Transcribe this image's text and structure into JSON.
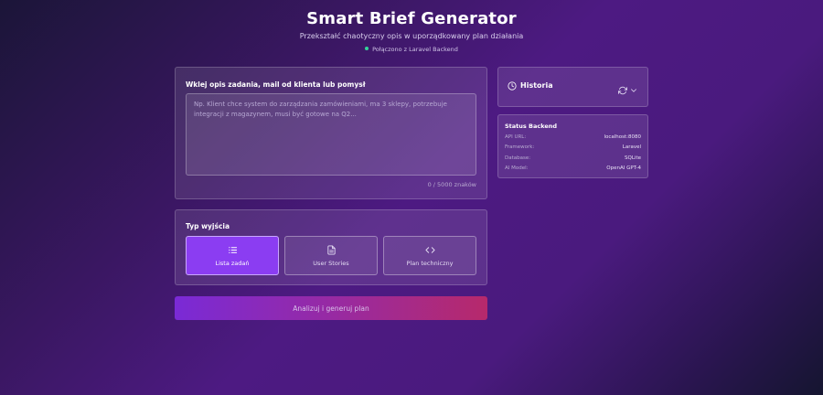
{
  "header": {
    "title": "Smart Brief Generator",
    "subtitle": "Przekształć chaotyczny opis w uporządkowany plan działania",
    "connection_status": "Połączono z Laravel Backend"
  },
  "input": {
    "label": "Wklej opis zadania, mail od klienta lub pomysł",
    "value": "",
    "placeholder": "Np. Klient chce system do zarządzania zamówieniami, ma 3 sklepy, potrzebuje integracji z magazynem, musi być gotowe na Q2...",
    "counter": "0 / 5000 znaków"
  },
  "output_type": {
    "label": "Typ wyjścia",
    "options": [
      {
        "label": "Lista zadań",
        "icon": "list-icon",
        "selected": true
      },
      {
        "label": "User Stories",
        "icon": "document-icon",
        "selected": false
      },
      {
        "label": "Plan techniczny",
        "icon": "code-icon",
        "selected": false
      }
    ]
  },
  "submit": {
    "label": "Analizuj i generuj plan"
  },
  "history": {
    "title": "Historia"
  },
  "backend_status": {
    "title": "Status Backend",
    "rows": [
      {
        "key": "API URL:",
        "value": "localhost:8080"
      },
      {
        "key": "Framework:",
        "value": "Laravel"
      },
      {
        "key": "Database:",
        "value": "SQLite"
      },
      {
        "key": "AI Model:",
        "value": "OpenAI GPT-4"
      }
    ]
  },
  "colors": {
    "accent": "#8b3df2",
    "status_dot": "#34d399",
    "submit_gradient_start": "#7a2ad6",
    "submit_gradient_end": "#b7296b"
  }
}
